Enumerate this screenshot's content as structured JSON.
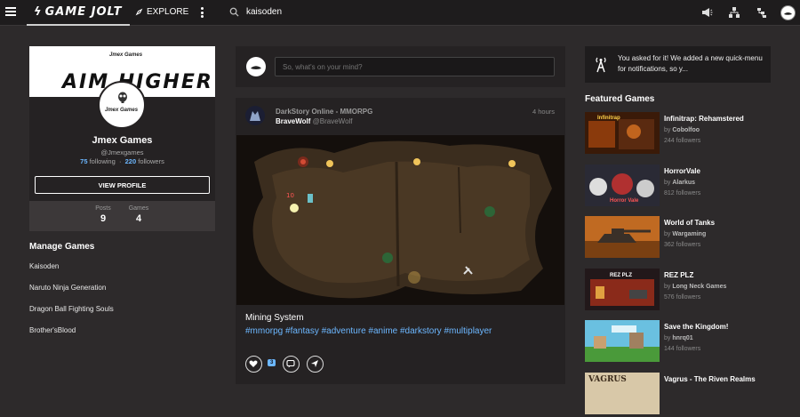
{
  "topbar": {
    "logo": "GAME JOLT",
    "explore": "EXPLORE",
    "search_value": "kaisoden"
  },
  "profile": {
    "banner_sub": "Jmex Games",
    "banner_big": "AIM HIGHER",
    "avatar_text": "Jmex Games",
    "name": "Jmex Games",
    "username": "@Jmexgames",
    "following_count": "75",
    "following_label": "following",
    "followers_count": "220",
    "followers_label": "followers",
    "view_profile": "VIEW PROFILE",
    "posts_label": "Posts",
    "posts_value": "9",
    "games_label": "Games",
    "games_value": "4"
  },
  "manage_games": {
    "title": "Manage Games",
    "items": [
      "Kaisoden",
      "Naruto Ninja Generation",
      "Dragon Ball Fighting Souls",
      "Brother'sBlood"
    ]
  },
  "composer": {
    "placeholder": "So, what's on your mind?"
  },
  "post": {
    "game": "DarkStory Online - MMORPG",
    "author": "BraveWolf",
    "handle": "@BraveWolf",
    "time": "4 hours",
    "title": "Mining System",
    "tags": "#mmorpg #fantasy #adventure #anime #darkstory #multiplayer",
    "like_count": "3",
    "damage_text": "10"
  },
  "notice": {
    "text": "You asked for it! We added a new quick-menu for notifications, so y..."
  },
  "featured": {
    "title": "Featured Games",
    "items": [
      {
        "name": "Infinitrap: Rehamstered",
        "by": "by",
        "author": "Cobolfoo",
        "followers": "244 followers",
        "thumb_label": "Infinitrap"
      },
      {
        "name": "HorrorVale",
        "by": "by",
        "author": "Alarkus",
        "followers": "812 followers",
        "thumb_label": "Horror Vale"
      },
      {
        "name": "World of Tanks",
        "by": "by",
        "author": "Wargaming",
        "followers": "362 followers",
        "thumb_label": ""
      },
      {
        "name": "REZ PLZ",
        "by": "by",
        "author": "Long Neck Games",
        "followers": "576 followers",
        "thumb_label": "REZ PLZ"
      },
      {
        "name": "Save the Kingdom!",
        "by": "by",
        "author": "hnrq01",
        "followers": "144 followers",
        "thumb_label": ""
      },
      {
        "name": "Vagrus - The Riven Realms",
        "by": "",
        "author": "",
        "followers": "",
        "thumb_label": "VAGRUS"
      }
    ]
  },
  "colors": {
    "accent_blue": "#6cb7ff",
    "bg": "#2d2a2b",
    "card": "#252223"
  }
}
